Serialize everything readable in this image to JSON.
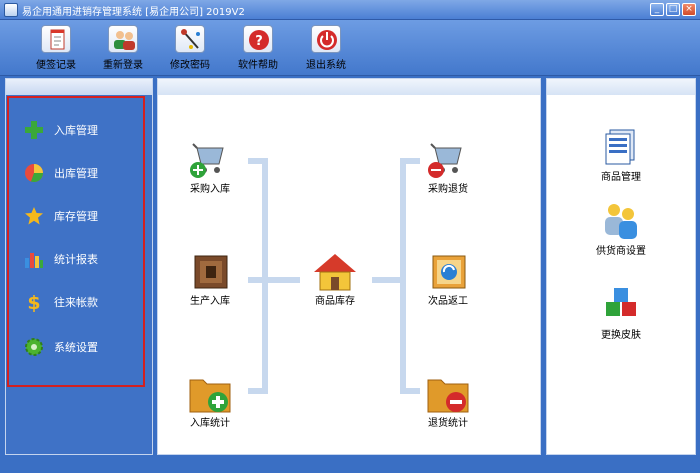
{
  "window": {
    "title": "易企用通用进销存管理系统 [易企用公司] 2019V2",
    "min": "_",
    "max": "□",
    "close": "×"
  },
  "toolbar": [
    {
      "label": "便签记录",
      "icon": "notepad-icon"
    },
    {
      "label": "重新登录",
      "icon": "users-icon"
    },
    {
      "label": "修改密码",
      "icon": "key-icon"
    },
    {
      "label": "软件帮助",
      "icon": "help-icon"
    },
    {
      "label": "退出系统",
      "icon": "power-icon"
    }
  ],
  "sidebar": [
    {
      "label": "入库管理",
      "icon": "green-plus-icon"
    },
    {
      "label": "出库管理",
      "icon": "pie-chart-icon"
    },
    {
      "label": "库存管理",
      "icon": "star-icon"
    },
    {
      "label": "统计报表",
      "icon": "bar-chart-icon"
    },
    {
      "label": "往来帐款",
      "icon": "dollar-icon"
    },
    {
      "label": "系统设置",
      "icon": "gear-icon"
    }
  ],
  "flow": {
    "left": [
      {
        "label": "采购入库",
        "icon": "cart-plus-icon"
      },
      {
        "label": "生产入库",
        "icon": "box-icon"
      },
      {
        "label": "入库统计",
        "icon": "folder-plus-icon"
      }
    ],
    "center": {
      "label": "商品库存",
      "icon": "house-icon"
    },
    "right": [
      {
        "label": "采购退货",
        "icon": "cart-minus-icon"
      },
      {
        "label": "次品返工",
        "icon": "rework-icon"
      },
      {
        "label": "退货统计",
        "icon": "folder-minus-icon"
      }
    ]
  },
  "rightpanel": [
    {
      "label": "商品管理",
      "icon": "documents-icon"
    },
    {
      "label": "供货商设置",
      "icon": "supplier-icon"
    },
    {
      "label": "更换皮肤",
      "icon": "cubes-icon"
    }
  ],
  "colors": {
    "accent": "#3a6fc4",
    "highlight": "#d42020"
  }
}
